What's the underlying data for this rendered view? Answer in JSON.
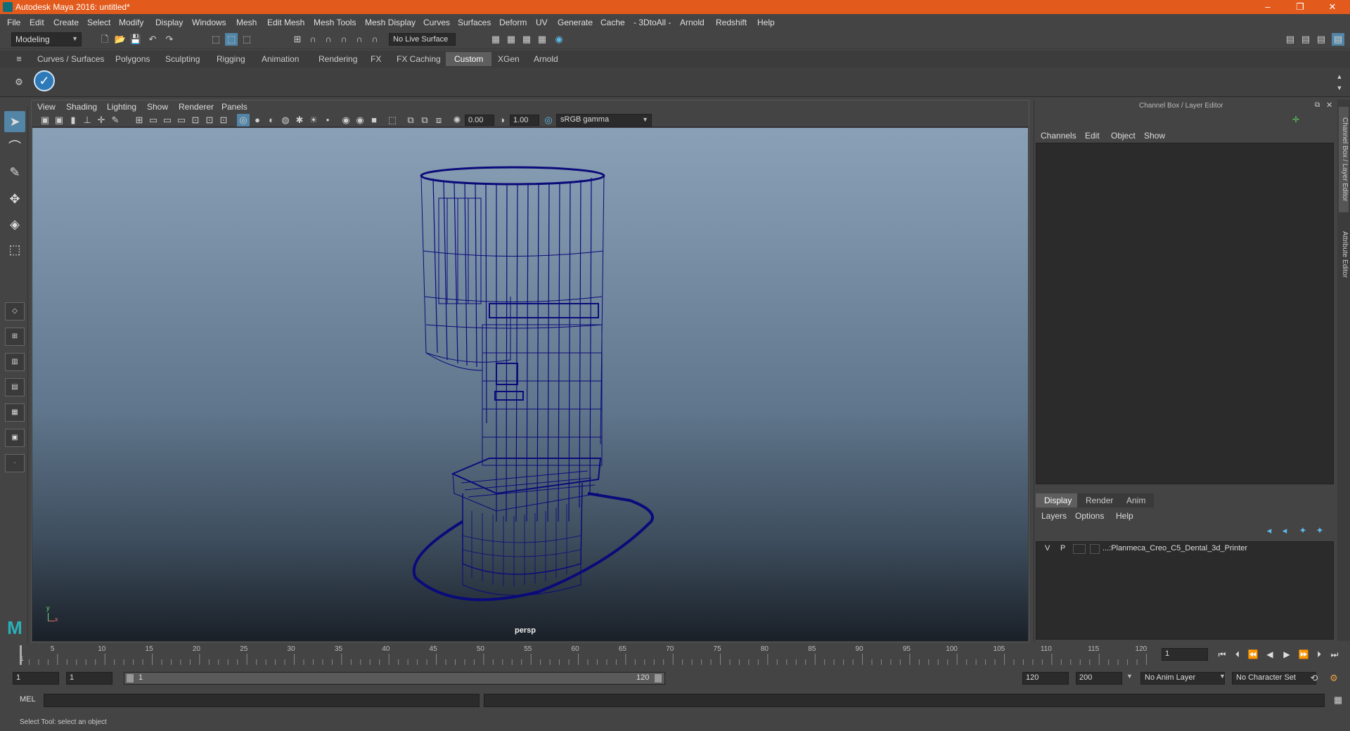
{
  "window": {
    "title": "Autodesk Maya 2016: untitled*",
    "min": "–",
    "max": "❐",
    "close": "✕"
  },
  "menus": [
    "File",
    "Edit",
    "Create",
    "Select",
    "Modify",
    "Display",
    "Windows",
    "Mesh",
    "Edit Mesh",
    "Mesh Tools",
    "Mesh Display",
    "Curves",
    "Surfaces",
    "Deform",
    "UV",
    "Generate",
    "Cache",
    "- 3DtoAll -",
    "Arnold",
    "Redshift",
    "Help"
  ],
  "status": {
    "mode": "Modeling",
    "live_surface": "No Live Surface"
  },
  "shelf_tabs": [
    "Curves / Surfaces",
    "Polygons",
    "Sculpting",
    "Rigging",
    "Animation",
    "Rendering",
    "FX",
    "FX Caching",
    "Custom",
    "XGen",
    "Arnold"
  ],
  "shelf_active": "Custom",
  "panel_menu": [
    "View",
    "Shading",
    "Lighting",
    "Show",
    "Renderer",
    "Panels"
  ],
  "panel_toolbar": {
    "exposure": "0.00",
    "gamma": "1.00",
    "color_space": "sRGB gamma"
  },
  "viewport": {
    "camera": "persp",
    "axis_y": "y",
    "axis_x": "x",
    "wire_color": "#0a0a7a"
  },
  "channel_box": {
    "title": "Channel Box / Layer Editor",
    "menu": [
      "Channels",
      "Edit",
      "Object",
      "Show"
    ]
  },
  "layer_editor": {
    "tabs": [
      "Display",
      "Render",
      "Anim"
    ],
    "active_tab": "Display",
    "menu": [
      "Layers",
      "Options",
      "Help"
    ],
    "layers": [
      {
        "v": "V",
        "p": "P",
        "name": "...:Planmeca_Creo_C5_Dental_3d_Printer"
      }
    ]
  },
  "side_tabs": [
    "Channel Box / Layer Editor",
    "Attribute Editor"
  ],
  "timeline": {
    "ticks": [
      5,
      10,
      15,
      20,
      25,
      30,
      35,
      40,
      45,
      50,
      55,
      60,
      65,
      70,
      75,
      80,
      85,
      90,
      95,
      100,
      105,
      110,
      115,
      120
    ],
    "first_label": "1",
    "current_frame": "1"
  },
  "range": {
    "start": "1",
    "inner_start": "1",
    "slider_start": "1",
    "slider_end": "120",
    "end": "120",
    "anim_end": "200",
    "anim_layer": "No Anim Layer",
    "character_set": "No Character Set"
  },
  "cmd": {
    "label": "MEL"
  },
  "help_line": "Select Tool: select an object"
}
